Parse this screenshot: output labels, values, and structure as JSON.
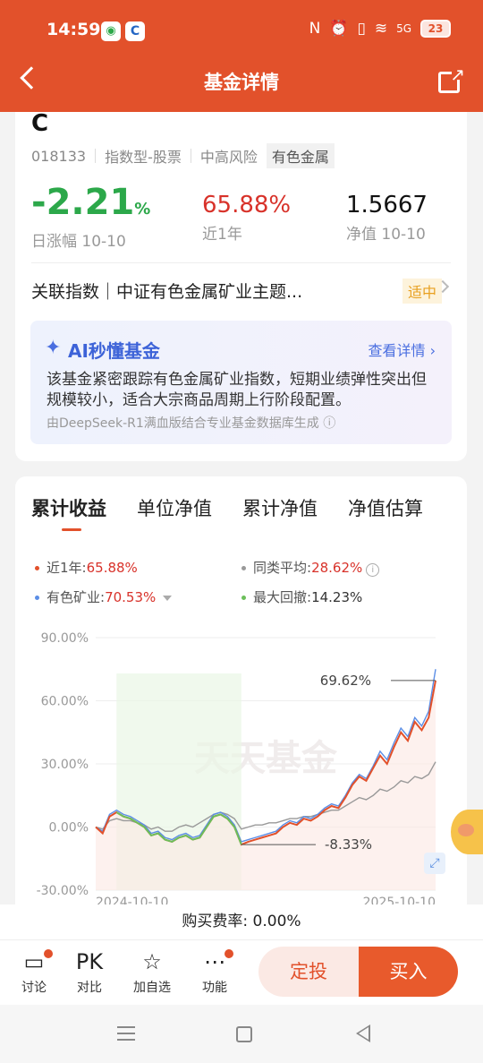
{
  "status_bar": {
    "time": "14:59",
    "app1_icon": "wechat-icon",
    "app2_icon": "browser-icon",
    "nfc": "N",
    "battery": "23",
    "network": "5G"
  },
  "nav": {
    "title": "基金详情",
    "back_icon": "back-chevron-icon",
    "share_icon": "share-icon"
  },
  "fund": {
    "name_tail": "C",
    "code": "018133",
    "type": "指数型-股票",
    "risk": "中高风险",
    "sector": "有色金属"
  },
  "stats": {
    "daily": {
      "value": "-2.21",
      "unit": "%",
      "label": "日涨幅 10-10"
    },
    "year": {
      "value": "65.88%",
      "label": "近1年"
    },
    "nav": {
      "value": "1.5667",
      "label": "净值 10-10"
    }
  },
  "index_row": {
    "text": "关联指数｜中证有色金属矿业主题...",
    "tag": "适中"
  },
  "ai": {
    "title": "AI秒懂基金",
    "more": "查看详情 ›",
    "body": "该基金紧密跟踪有色金属矿业指数，短期业绩弹性突出但规模较小，适合大宗商品周期上行阶段配置。",
    "footer": "由DeepSeek-R1满血版结合专业基金数据库生成 ⓘ"
  },
  "tabs": [
    "累计收益",
    "单位净值",
    "累计净值",
    "净值估算"
  ],
  "legend": {
    "fund": {
      "label": "近1年:",
      "value": "65.88%",
      "color": "#e2512b"
    },
    "peer": {
      "label": "同类平均:",
      "value": "28.62%",
      "color": "#999999"
    },
    "index": {
      "label": "有色矿业:",
      "value": "70.53%",
      "color": "#5b8ee6"
    },
    "drawdown": {
      "label": "最大回撤:",
      "value": "14.23%",
      "color": "#6cbf5a"
    }
  },
  "chart_data": {
    "type": "line",
    "ylim": [
      -30,
      90
    ],
    "yticks": [
      "90.00%",
      "60.00%",
      "30.00%",
      "0.00%",
      "-30.00%"
    ],
    "xticks": [
      "2024-10-10",
      "2025-10-10"
    ],
    "watermark": "天天基金",
    "annotations": [
      {
        "text": "69.62%",
        "value": 69.62
      },
      {
        "text": "-8.33%",
        "value": -8.33
      }
    ],
    "series": [
      {
        "name": "近1年",
        "color": "#e2512b",
        "values": [
          0,
          -3,
          5,
          7,
          5,
          4,
          2,
          0,
          -4,
          -3,
          -6,
          -7,
          -5,
          -4,
          -6,
          -5,
          0,
          5,
          6,
          4,
          0,
          -8.33,
          -7,
          -6,
          -5,
          -4,
          -3,
          0,
          2,
          1,
          4,
          3,
          5,
          8,
          10,
          9,
          14,
          20,
          24,
          22,
          28,
          34,
          30,
          38,
          45,
          41,
          50,
          46,
          52,
          69.62
        ]
      },
      {
        "name": "有色矿业",
        "color": "#5b8ee6",
        "values": [
          0,
          -2,
          6,
          8,
          6,
          5,
          3,
          1,
          -3,
          -2,
          -5,
          -6,
          -4,
          -3,
          -5,
          -4,
          1,
          6,
          7,
          5,
          1,
          -7,
          -6,
          -5,
          -4,
          -3,
          -2,
          1,
          3,
          2,
          5,
          4,
          6,
          9,
          11,
          10,
          15,
          21,
          25,
          23,
          29,
          36,
          32,
          40,
          47,
          43,
          52,
          48,
          55,
          75
        ]
      },
      {
        "name": "同类平均",
        "color": "#999999",
        "values": [
          0,
          -1,
          3,
          4,
          3,
          3,
          2,
          1,
          -1,
          0,
          -2,
          -2,
          0,
          1,
          0,
          2,
          4,
          6,
          7,
          6,
          4,
          -1,
          0,
          1,
          1,
          2,
          2,
          3,
          4,
          4,
          5,
          5,
          6,
          7,
          8,
          8,
          10,
          12,
          14,
          13,
          15,
          18,
          17,
          19,
          22,
          21,
          24,
          23,
          25,
          31
        ]
      }
    ],
    "drawdown_range": [
      3,
      21
    ]
  },
  "buy_rate": "购买费率: 0.00%",
  "bottom_bar": {
    "items": [
      {
        "icon": "chat-bubble-icon",
        "label": "讨论",
        "badge": true
      },
      {
        "icon": "pk-icon",
        "label": "对比",
        "glyph": "PK",
        "badge": false
      },
      {
        "icon": "star-icon",
        "label": "加自选",
        "badge": false
      },
      {
        "icon": "more-dots-icon",
        "label": "功能",
        "badge": true
      }
    ],
    "fixed_invest": "定投",
    "buy": "买入"
  }
}
